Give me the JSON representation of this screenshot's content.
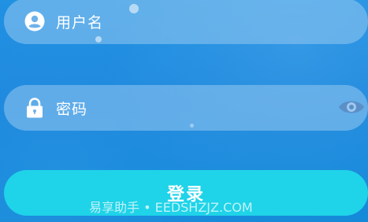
{
  "form": {
    "username_placeholder": "用户名",
    "password_placeholder": "密码",
    "login_label": "登录"
  },
  "icons": {
    "username": "user-circle-icon",
    "password": "lock-icon",
    "toggle_visibility": "eye-icon"
  },
  "watermark": "易享助手 • EEDSHZJZ.COM",
  "colors": {
    "background": "#1a86dc",
    "field_fill": "#96c8f0",
    "login_button": "#1fd3e8",
    "text": "#ffffff"
  }
}
